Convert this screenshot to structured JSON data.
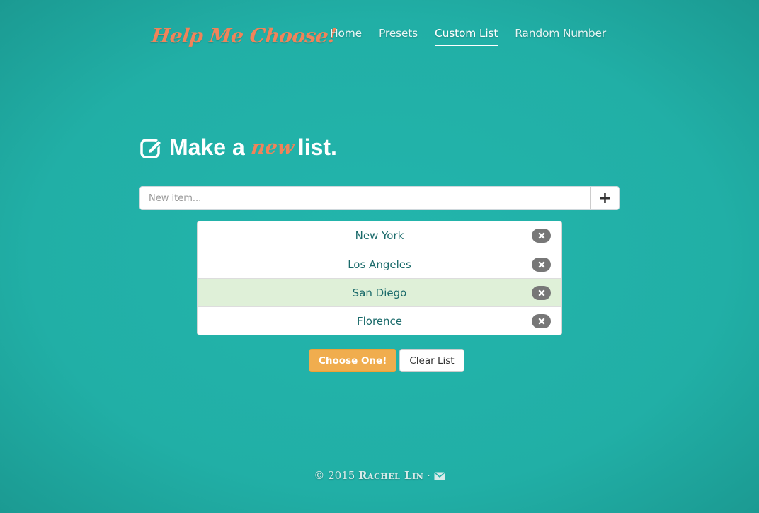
{
  "logo": {
    "text": "Help Me Choose!"
  },
  "nav": {
    "items": [
      {
        "label": "Home",
        "active": false
      },
      {
        "label": "Presets",
        "active": false
      },
      {
        "label": "Custom List",
        "active": true
      },
      {
        "label": "Random Number",
        "active": false
      }
    ]
  },
  "heading": {
    "prefix": "Make a",
    "accent": "new",
    "suffix": "list.",
    "icon": "edit-icon"
  },
  "new_item": {
    "placeholder": "New item...",
    "value": "",
    "add_icon": "plus-icon"
  },
  "list": {
    "items": [
      {
        "label": "New York",
        "highlighted": false
      },
      {
        "label": "Los Angeles",
        "highlighted": false
      },
      {
        "label": "San Diego",
        "highlighted": true
      },
      {
        "label": "Florence",
        "highlighted": false
      }
    ],
    "remove_icon": "close-icon"
  },
  "actions": {
    "choose_label": "Choose One!",
    "clear_label": "Clear List"
  },
  "footer": {
    "copyright": "© 2015",
    "author": "Rachel Lin",
    "separator": "·",
    "mail_icon": "mail-icon"
  },
  "colors": {
    "background": "#22b1a8",
    "accent": "#f0845a",
    "primary_button": "#f0ad4e",
    "highlight_row": "#dff0d8",
    "list_text": "#1a6a6a"
  }
}
